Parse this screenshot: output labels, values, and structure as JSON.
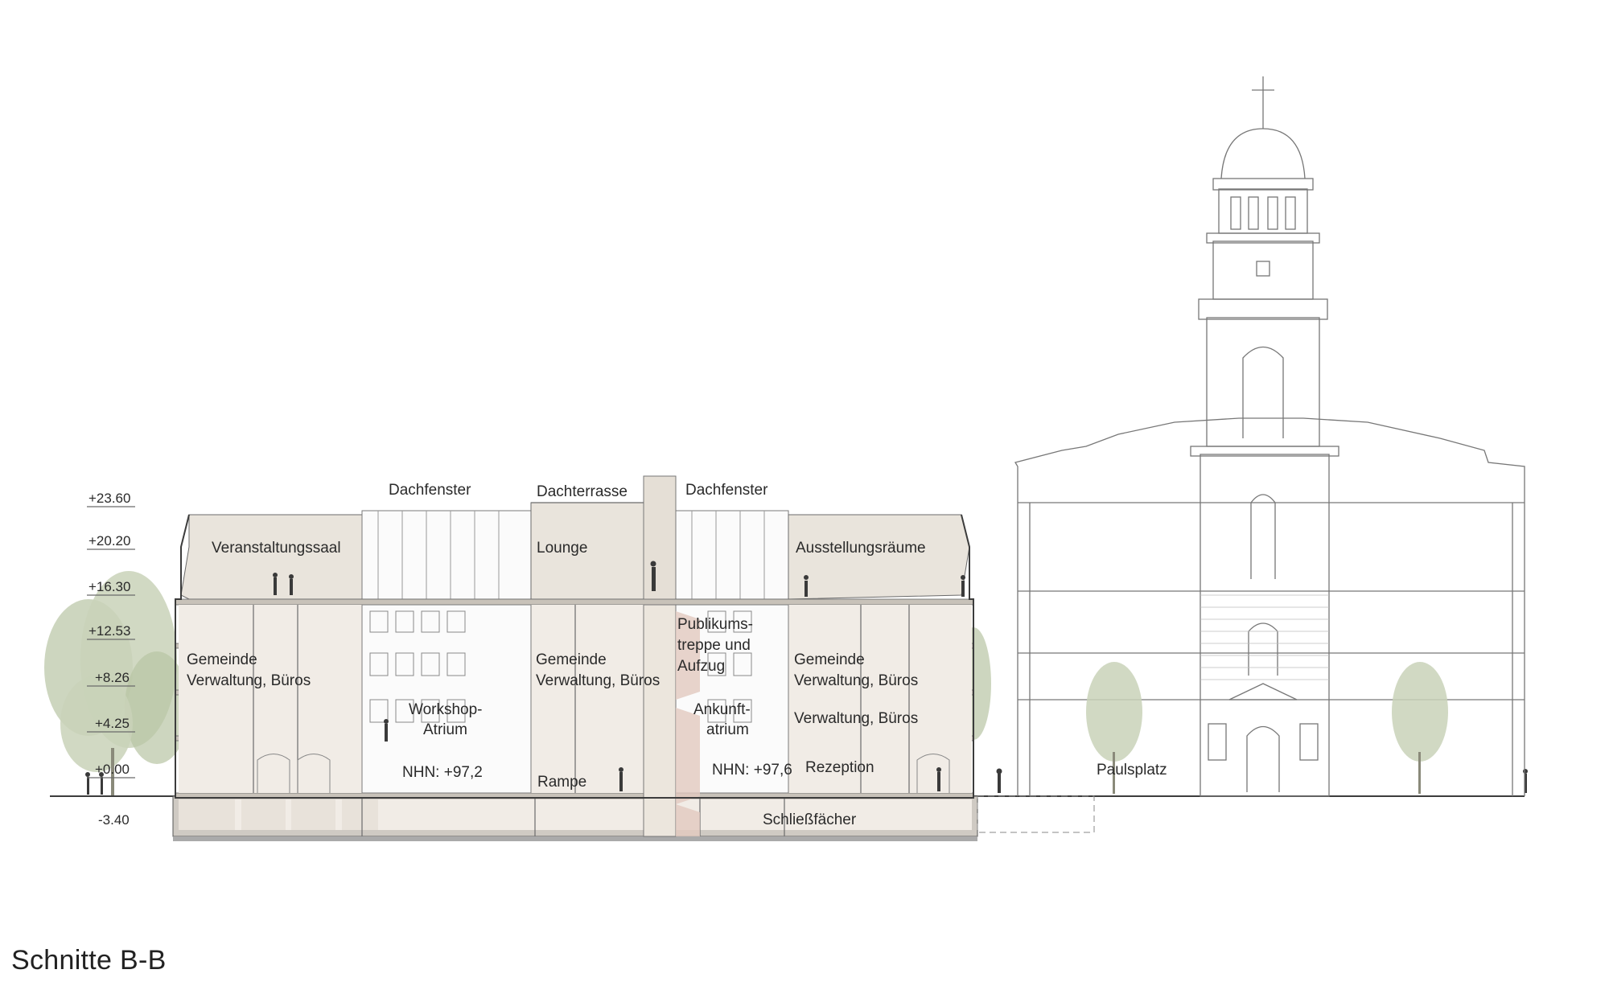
{
  "caption": "Schnitte B-B",
  "levels": [
    "+23.60",
    "+20.20",
    "+16.30",
    "+12.53",
    "+8.26",
    "+4.25",
    "+0.00",
    "-3.40"
  ],
  "labels": {
    "dachfenster_left": "Dachfenster",
    "dachterrasse": "Dachterrasse",
    "dachfenster_right": "Dachfenster",
    "veranstaltungssaal": "Veranstaltungssaal",
    "lounge": "Lounge",
    "ausstellungsraeume": "Ausstellungsräume",
    "publikums_1": "Publikums-",
    "publikums_2": "treppe und",
    "publikums_3": "Aufzug",
    "gemeinde_left_1": "Gemeinde",
    "gemeinde_left_2": "Verwaltung, Büros",
    "gemeinde_mid_1": "Gemeinde",
    "gemeinde_mid_2": "Verwaltung, Büros",
    "gemeinde_right_1": "Gemeinde",
    "gemeinde_right_2": "Verwaltung, Büros",
    "verwaltung_right": "Verwaltung, Büros",
    "workshop_1": "Workshop-",
    "workshop_2": "Atrium",
    "ankunft_1": "Ankunft-",
    "ankunft_2": "atrium",
    "nhn_left": "NHN: +97,2",
    "nhn_right": "NHN: +97,6",
    "rampe": "Rampe",
    "rezeption": "Rezeption",
    "schliessfaecher": "Schließfächer",
    "paulsplatz": "Paulsplatz"
  }
}
